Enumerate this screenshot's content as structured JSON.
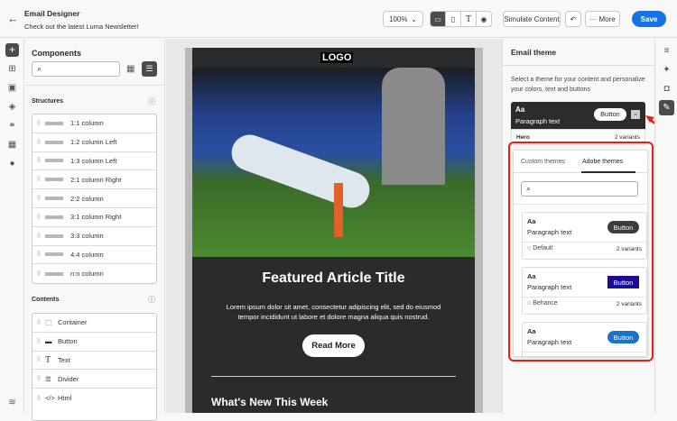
{
  "header": {
    "title": "Email Designer",
    "subtitle": "Check out the latest Luma Newsletter!",
    "zoom": "100%",
    "simulate": "Simulate Content",
    "more": "More",
    "save": "Save"
  },
  "components": {
    "title": "Components",
    "structures_label": "Structures",
    "contents_label": "Contents",
    "structures": [
      "1:1 column",
      "1:2 column Left",
      "1:3 column Left",
      "2:1 column Right",
      "2:2 column",
      "3:1 column Right",
      "3:3 column",
      "4:4 column",
      "n:n column"
    ],
    "contents": [
      "Container",
      "Button",
      "Text",
      "Divider",
      "Html"
    ]
  },
  "email": {
    "logo": "LOGO",
    "title": "Featured Article Title",
    "body": "Lorem ipsum dolor sit amet, consectetur adipiscing elit, sed do eiusmod tempor incididunt ut labore et dolore magna aliqua quis nostrud.",
    "cta": "Read More",
    "section": "What's New This Week"
  },
  "theme": {
    "title": "Email theme",
    "description": "Select a theme for your content and personalize your colors, text and buttons",
    "current": {
      "aa": "Aa",
      "paragraph": "Paragraph text",
      "button": "Button",
      "name": "Hero",
      "variants": "2 variants"
    },
    "tabs": [
      "Custom themes",
      "Adobe themes"
    ],
    "active_tab": 1,
    "themes": [
      {
        "aa": "Aa",
        "paragraph": "Paragraph text",
        "button": "Button",
        "name": "Default",
        "variants": "2 variants",
        "button_color": "#3c3c3c"
      },
      {
        "aa": "Aa",
        "paragraph": "Paragraph text",
        "button": "Button",
        "name": "Behance",
        "variants": "2 variants",
        "button_color": "#1a0d9c"
      },
      {
        "aa": "Aa",
        "paragraph": "Paragraph text",
        "button": "Button",
        "button_color": "#1a73c8"
      }
    ]
  },
  "colors": {
    "accent": "#1473e6",
    "highlight": "#e0201b"
  }
}
